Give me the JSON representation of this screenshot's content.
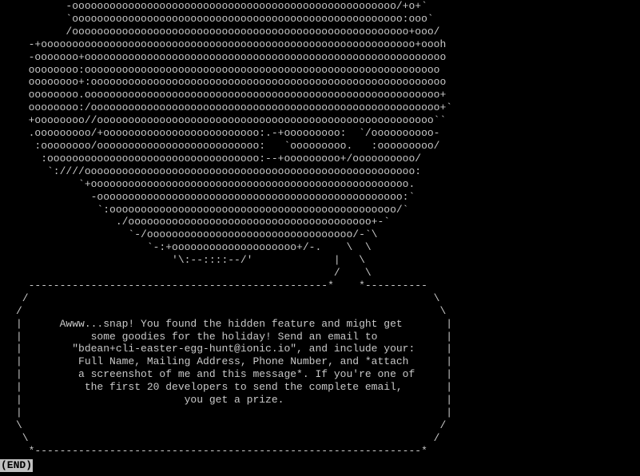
{
  "terminal": {
    "art_text": "        -oooooooooooooooooooooooooooooooooooooooooooooooooooo/+o+`\n        `ooooooooooooooooooooooooooooooooooooooooooooooooooooo:ooo`\n        /oooooooooooooooooooooooooooooooooooooooooooooooooooooo+ooo/\n  -+oooooooooooooooooooooooooooooooooooooooooooooooooooooooooooo+oooh\n  -ooooooo+oooooooooooooooooooooooooooooooooooooooooooooooooooooooooo\n  oooooooo:ooooooooooooooooooooooooooooooooooooooooooooooooooooooooo\n  oooooooo+:ooooooooooooooooooooooooooooooooooooooooooooooooooooooooo\n  oooooooo.ooooooooooooooooooooooooooooooooooooooooooooooooooooooooo+\n  oooooooo:/oooooooooooooooooooooooooooooooooooooooooooooooooooooooo+`\n  +oooooooo//oooooooooooooooooooooooooooooooooooooooooooooooooooooo``\n  .ooooooooo/+ooooooooooooooooooooooooo:.-+ooooooooo:  `/oooooooooo-\n   :oooooooo/oooooooooooooooooooooooooo:   `ooooooooo.   :ooooooooo/\n    :oooooooooooooooooooooooooooooooooo:--+ooooooooo+/oooooooooo/\n     `:////ooooooooooooooooooooooooooooooooooooooooooooooooooooo:\n          `+ooooooooooooooooooooooooooooooooooooooooooooooooooo.\n            -ooooooooooooooooooooooooooooooooooooooooooooooooo:`\n             `:oooooooooooooooooooooooooooooooooooooooooooooo/`\n                ./ooooooooooooooooooooooooooooooooooooooo+-`\n                  `-/ooooooooooooooooooooooooooooooooo/-`\\\n                     `-:+oooooooooooooooooooo+/-.    \\  \\\n                         '\\:--::::--/'             |   \\\n                                                   /    \\\n  ------------------------------------------------*    *----------\n /                                                                 \\\n/                                                                   \\\n|      Awww...snap! You found the hidden feature and might get       |\n|           some goodies for the holiday! Send an email to           |\n|        \"bdean+cli-easter-egg-hunt@ionic.io\", and include your:     |\n|         Full Name, Mailing Address, Phone Number, and *attach      |\n|         a screenshot of me and this message*. If you're one of     |\n|          the first 20 developers to send the complete email,       |\n|                          you get a prize.                          |\n|                                                                    |\n\\                                                                   /\n \\                                                                 /\n  *--------------------------------------------------------------*",
    "end_label": "(END)"
  },
  "colors": {
    "background": "#000000",
    "foreground": "#c8c8c8",
    "end_marker_bg": "#c0c0c0",
    "end_marker_fg": "#000000"
  }
}
